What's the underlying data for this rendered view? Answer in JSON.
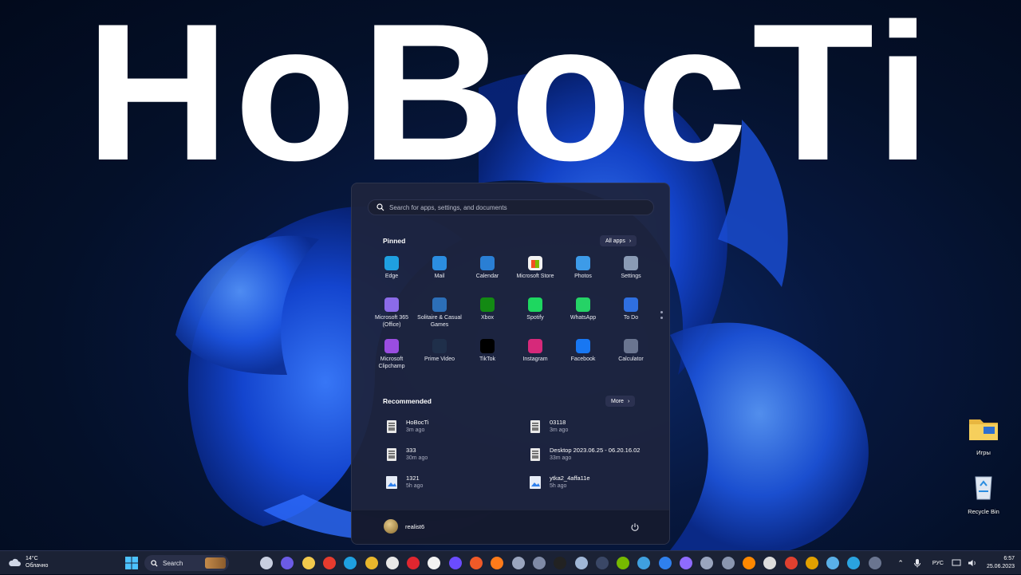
{
  "headline": "HoBocTi",
  "start_menu": {
    "search_placeholder": "Search for apps, settings, and documents",
    "pinned_title": "Pinned",
    "all_apps_label": "All apps",
    "pinned_apps": [
      {
        "label": "Edge",
        "icon": "edge-icon",
        "color": "#1fa0e0"
      },
      {
        "label": "Mail",
        "icon": "mail-icon",
        "color": "#2b8de0"
      },
      {
        "label": "Calendar",
        "icon": "calendar-icon",
        "color": "#2a7fd4"
      },
      {
        "label": "Microsoft Store",
        "icon": "store-icon",
        "color": "#f2f2f2"
      },
      {
        "label": "Photos",
        "icon": "photos-icon",
        "color": "#3d9be8"
      },
      {
        "label": "Settings",
        "icon": "gear-icon",
        "color": "#8a9bb5"
      },
      {
        "label": "Microsoft 365 (Office)",
        "icon": "office-icon",
        "color": "#8b6be8"
      },
      {
        "label": "Solitaire & Casual Games",
        "icon": "solitaire-icon",
        "color": "#2c6fb8"
      },
      {
        "label": "Xbox",
        "icon": "xbox-icon",
        "color": "#138a13"
      },
      {
        "label": "Spotify",
        "icon": "spotify-icon",
        "color": "#1ed760"
      },
      {
        "label": "WhatsApp",
        "icon": "whatsapp-icon",
        "color": "#25d366"
      },
      {
        "label": "To Do",
        "icon": "todo-icon",
        "color": "#2f6fe0"
      },
      {
        "label": "Microsoft Clipchamp",
        "icon": "clipchamp-icon",
        "color": "#9a4de0"
      },
      {
        "label": "Prime Video",
        "icon": "prime-video-icon",
        "color": "#1f2f4a"
      },
      {
        "label": "TikTok",
        "icon": "tiktok-icon",
        "color": "#000000"
      },
      {
        "label": "Instagram",
        "icon": "instagram-icon",
        "color": "#d6297a"
      },
      {
        "label": "Facebook",
        "icon": "facebook-icon",
        "color": "#1877f2"
      },
      {
        "label": "Calculator",
        "icon": "calculator-icon",
        "color": "#6a7590"
      }
    ],
    "recommended_title": "Recommended",
    "more_label": "More",
    "recommended": [
      {
        "name": "HoBocTi",
        "time": "3m ago",
        "icon": "image-file-icon"
      },
      {
        "name": "03118",
        "time": "3m ago",
        "icon": "image-file-icon"
      },
      {
        "name": "333",
        "time": "30m ago",
        "icon": "image-file-icon"
      },
      {
        "name": "Desktop 2023.06.25 - 06.20.16.02",
        "time": "33m ago",
        "icon": "image-file-icon"
      },
      {
        "name": "1321",
        "time": "5h ago",
        "icon": "picture-file-icon"
      },
      {
        "name": "ytka2_4affa11e",
        "time": "5h ago",
        "icon": "picture-file-icon"
      }
    ],
    "user_name": "realist6"
  },
  "desktop_icons": [
    {
      "label": "Игры",
      "icon": "folder-icon"
    },
    {
      "label": "Recycle Bin",
      "icon": "recycle-bin-icon"
    }
  ],
  "taskbar": {
    "weather_temp": "14°C",
    "weather_desc": "Облачно",
    "search_label": "Search",
    "language": "РУС",
    "time": "6:57",
    "date": "25.06.2023",
    "apps": [
      {
        "icon": "task-view-icon",
        "color": "#c9cfe0"
      },
      {
        "icon": "teams-chat-icon",
        "color": "#6b5be6"
      },
      {
        "icon": "file-explorer-icon",
        "color": "#f2c94c"
      },
      {
        "icon": "yandex-icon",
        "color": "#e63b2e"
      },
      {
        "icon": "edge-icon",
        "color": "#1fa0e0"
      },
      {
        "icon": "chrome-icon",
        "color": "#e9b72c"
      },
      {
        "icon": "yandex-browser-icon",
        "color": "#e8e8e8"
      },
      {
        "icon": "opera-icon",
        "color": "#e0262f"
      },
      {
        "icon": "store-icon",
        "color": "#f2f2f2"
      },
      {
        "icon": "video-editor-icon",
        "color": "#6b4cff"
      },
      {
        "icon": "music-app-icon",
        "color": "#f05a28"
      },
      {
        "icon": "firefox-icon",
        "color": "#ff7b1a"
      },
      {
        "icon": "tool-icon",
        "color": "#9aa5be"
      },
      {
        "icon": "document-icon",
        "color": "#7f8aa6"
      },
      {
        "icon": "epic-games-icon",
        "color": "#222222"
      },
      {
        "icon": "steam-icon",
        "color": "#9fb6d6"
      },
      {
        "icon": "media-icon",
        "color": "#3a4766"
      },
      {
        "icon": "nvidia-icon",
        "color": "#76b900"
      },
      {
        "icon": "network-icon",
        "color": "#3fa0e0"
      },
      {
        "icon": "browser-icon",
        "color": "#2f80ed"
      },
      {
        "icon": "alice-icon",
        "color": "#8f6bff"
      },
      {
        "icon": "gear-icon",
        "color": "#9aa5be"
      },
      {
        "icon": "camera-icon",
        "color": "#8a96b0"
      },
      {
        "icon": "vlc-icon",
        "color": "#ff8800"
      },
      {
        "icon": "g-hub-icon",
        "color": "#dddddd"
      },
      {
        "icon": "record-icon",
        "color": "#e0402f"
      },
      {
        "icon": "shield-icon",
        "color": "#e2a000"
      },
      {
        "icon": "notepad-icon",
        "color": "#5ab0e8"
      },
      {
        "icon": "telegram-icon",
        "color": "#2aa3e0"
      },
      {
        "icon": "calculator-icon",
        "color": "#6a7590"
      }
    ]
  }
}
